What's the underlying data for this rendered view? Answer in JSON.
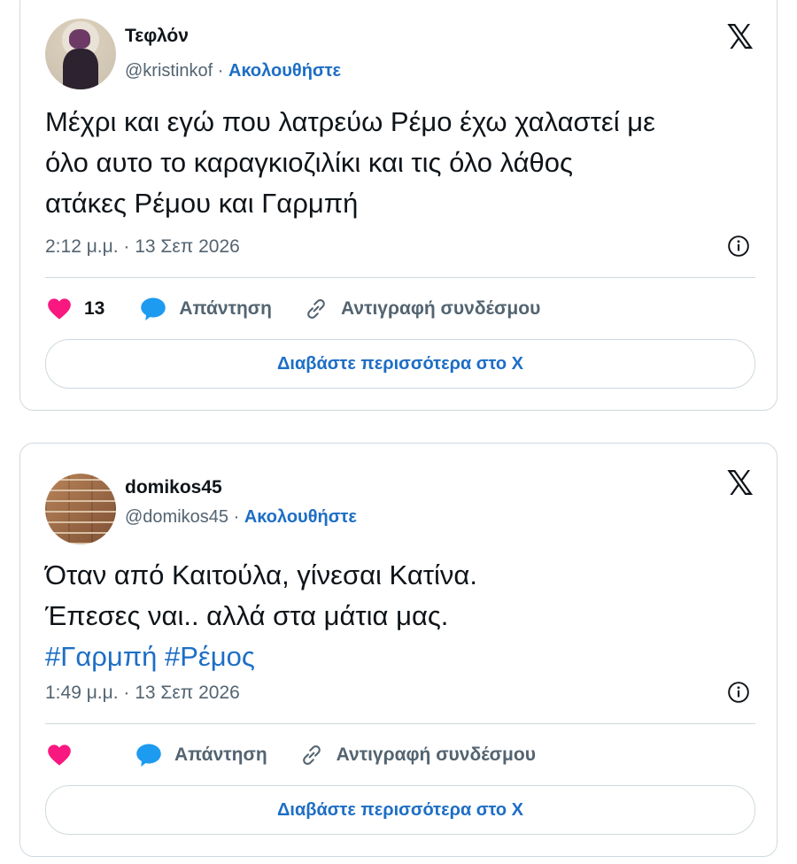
{
  "tweets": [
    {
      "display_name": "Τεφλόν",
      "handle": "@kristinkof",
      "separator": " · ",
      "follow_label": "Ακολουθήστε",
      "text_lines": [
        "Μέχρι και εγώ που λατρεύω Ρέμο έχω χαλαστεί με",
        "όλο αυτο το καραγκιοζιλίκι  και τις όλο λάθος",
        "ατάκες Ρέμου και Γαρμπή"
      ],
      "timestamp": "2:12 μ.μ. · 13 Σεπ 2026",
      "likes": "13",
      "reply_label": "Απάντηση",
      "copy_link_label": "Αντιγραφή συνδέσμου",
      "read_more_label": "Διαβάστε περισσότερα στο X"
    },
    {
      "display_name": "domikos45",
      "handle": "@domikos45",
      "separator": " · ",
      "follow_label": "Ακολουθήστε",
      "text_lines": [
        "Όταν από Καιτούλα, γίνεσαι Κατίνα.",
        "Έπεσες ναι.. αλλά στα μάτια μας."
      ],
      "hashtags": [
        "#Γαρμπή",
        "#Ρέμος"
      ],
      "timestamp": "1:49 μ.μ. · 13 Σεπ 2026",
      "reply_label": "Απάντηση",
      "copy_link_label": "Αντιγραφή συνδέσμου",
      "read_more_label": "Διαβάστε περισσότερα στο X"
    }
  ],
  "brand": {
    "logo_text": "𝕏"
  },
  "colors": {
    "link": "#1d6ec5",
    "heart": "#f91880",
    "reply": "#1d9bf0",
    "muted": "#536471",
    "border": "#cfd9de"
  },
  "icons": [
    "x-logo-icon",
    "info-icon",
    "heart-icon",
    "reply-bubble-icon",
    "link-icon"
  ]
}
